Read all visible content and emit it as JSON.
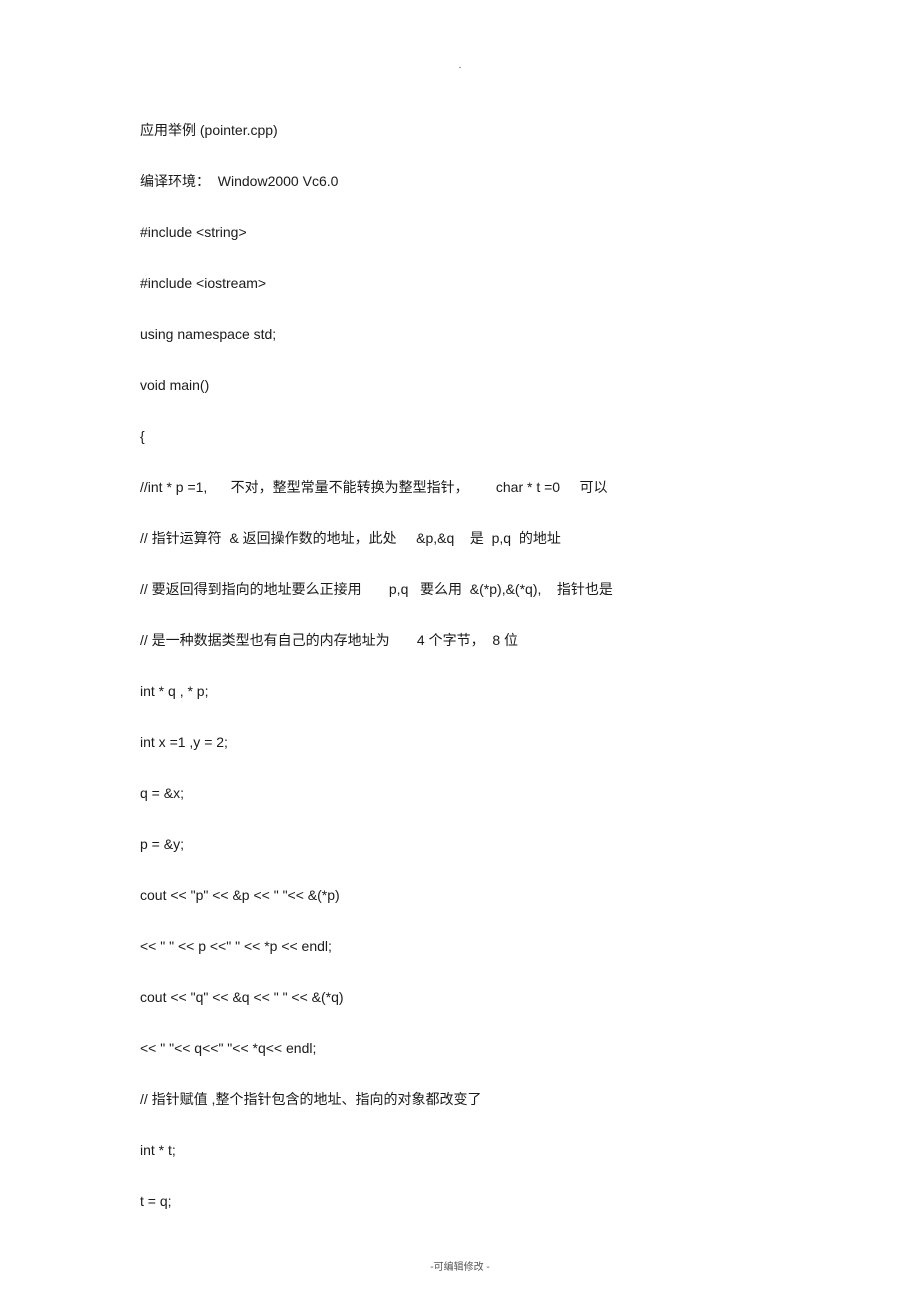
{
  "top_mark": ".",
  "lines": [
    "应用举例 (pointer.cpp)",
    "编译环境：  Window2000 Vc6.0",
    "#include <string>",
    "#include <iostream>",
    "using namespace std;",
    "void main()",
    "{",
    "//int * p =1,      不对，整型常量不能转换为整型指针，       char * t =0     可以",
    "// 指针运算符  & 返回操作数的地址，此处     &p,&q    是  p,q  的地址",
    "// 要返回得到指向的地址要么正接用       p,q   要么用  &(*p),&(*q),    指针也是",
    "// 是一种数据类型也有自己的内存地址为       4 个字节，  8 位",
    "int * q , * p;",
    "int x =1 ,y = 2;",
    "q = &x;",
    "p = &y;",
    "cout << \"p\" << &p << \" \"<< &(*p)",
    "<< \" \" << p <<\" \" << *p << endl;",
    "cout << \"q\" << &q << \" \" << &(*q)",
    "<< \" \"<< q<<\" \"<< *q<< endl;",
    "// 指针赋值 ,整个指针包含的地址、指向的对象都改变了",
    "int * t;",
    "t = q;"
  ],
  "footer": "-可编辑修改 -"
}
